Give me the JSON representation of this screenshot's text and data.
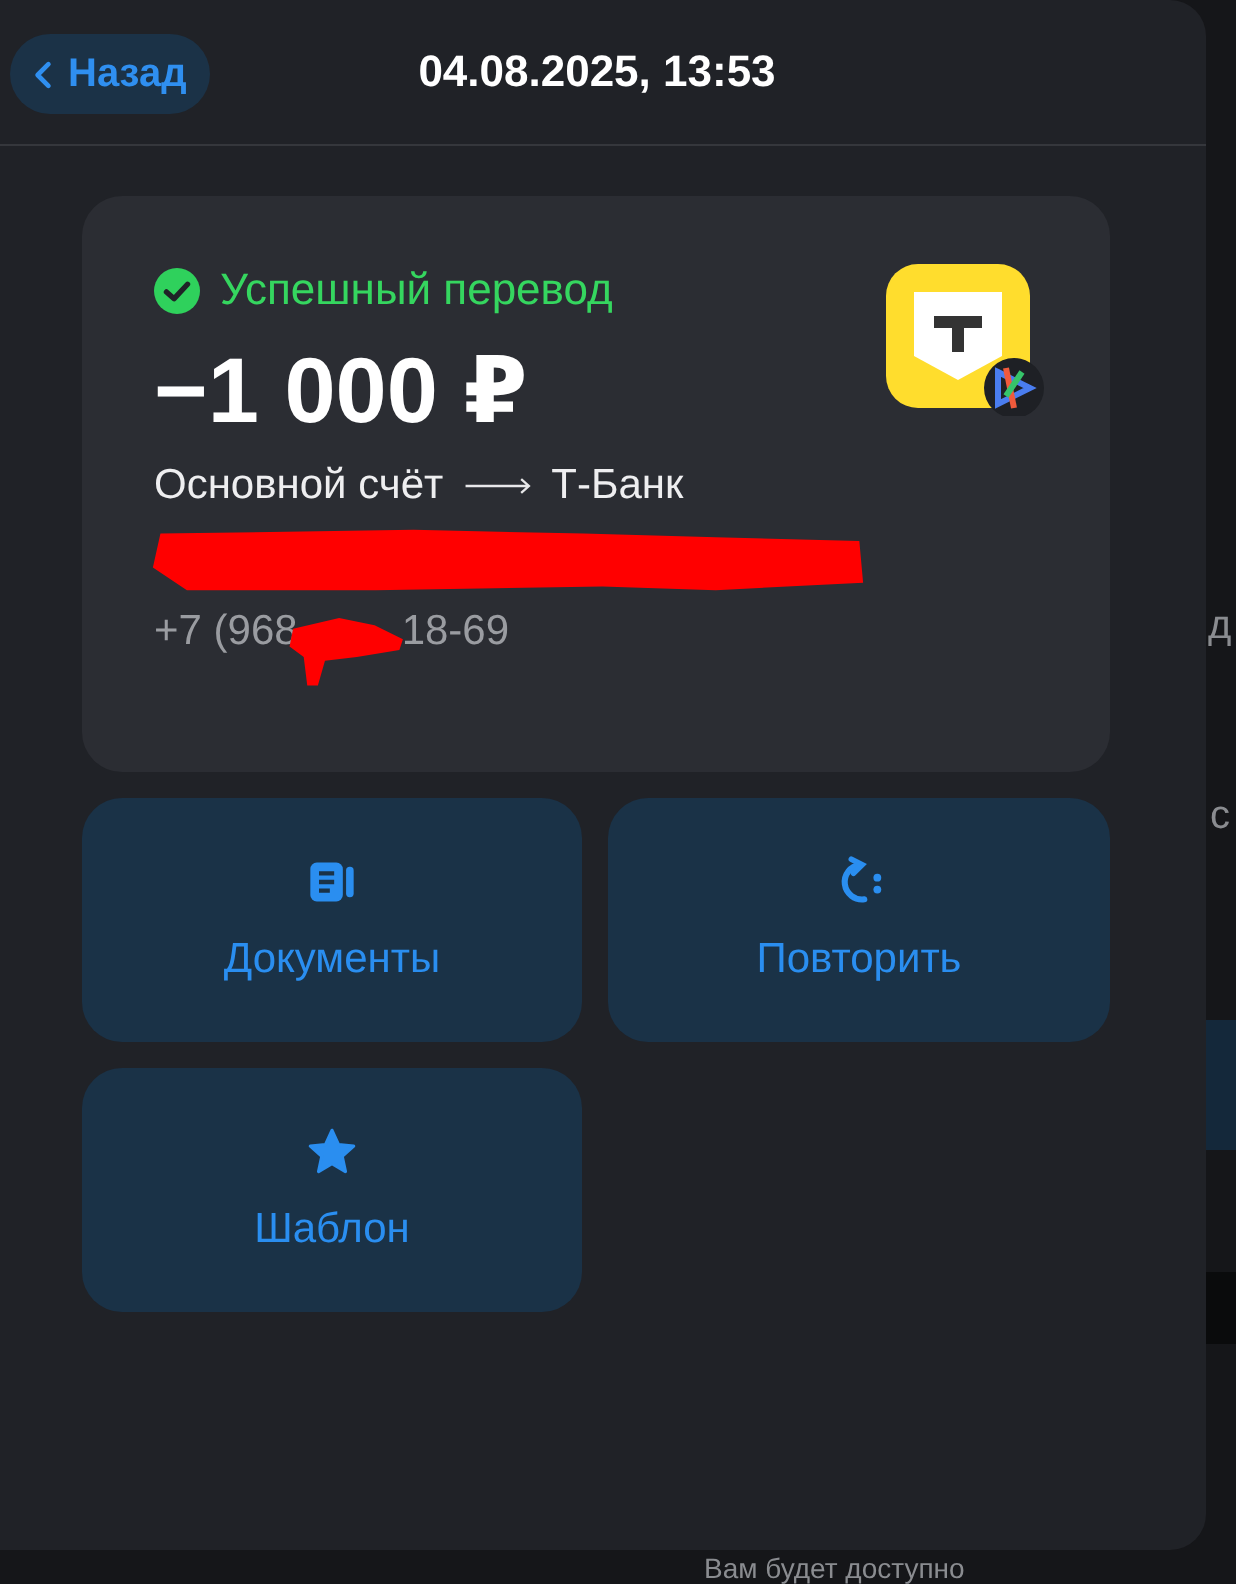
{
  "header": {
    "back_label": "Назад",
    "title": "04.08.2025, 13:53"
  },
  "transfer": {
    "status": {
      "kind": "success",
      "label": "Успешный перевод"
    },
    "amount": "−1 000 ₽",
    "from": "Основной счёт",
    "to": "Т-Банк",
    "recipient_redacted": true,
    "phone_start": "+7 (968",
    "phone_redacted": true,
    "phone_end": "18-69"
  },
  "actions": [
    {
      "label": "Документы"
    },
    {
      "label": "Повторить"
    },
    {
      "label": "Шаблон"
    }
  ],
  "background_text": [
    {
      "text": "д"
    },
    {
      "text": "с"
    },
    {
      "text": "Вам будет доступно"
    }
  ]
}
